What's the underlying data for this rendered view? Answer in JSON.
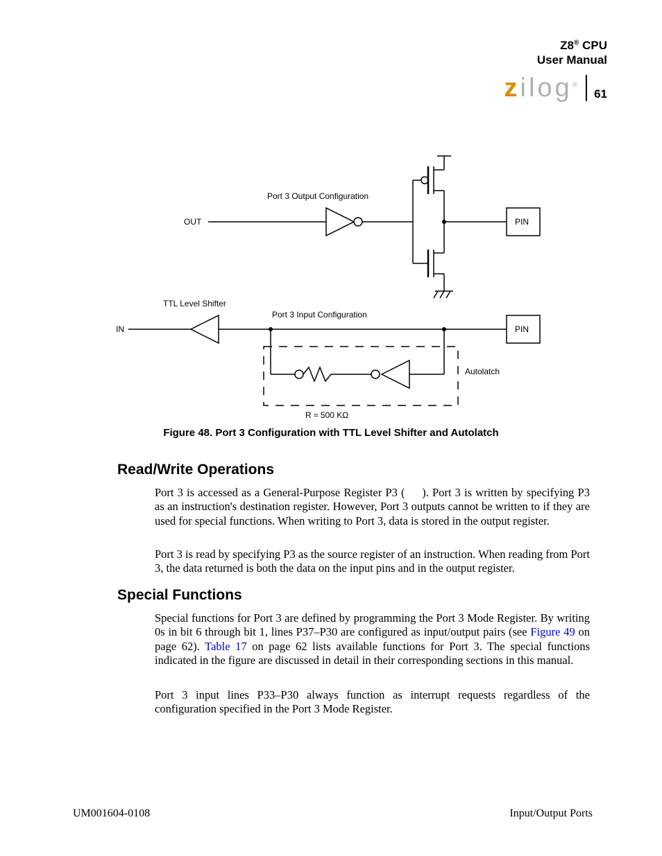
{
  "header": {
    "line1_before_sup": "Z8",
    "line1_sup": "®",
    "line1_after_sup": " CPU",
    "line2": "User Manual"
  },
  "logo": {
    "z": "z",
    "rest": "ilog"
  },
  "page_number": "61",
  "figure": {
    "labels": {
      "output_conf": "Port 3 Output Configuration",
      "input_conf": "Port 3 Input Configuration",
      "out": "OUT",
      "in": "IN",
      "ttl": "TTL Level Shifter",
      "autolatch": "Autolatch",
      "r_approx": "R  ≈  500 KΩ",
      "pin": "PIN"
    },
    "caption": {
      "lead": "Figure 48.",
      "text": " Port 3 Configuration with TTL Level Shifter and Autolatch"
    }
  },
  "sections": {
    "rw_heading": "Read/Write Operations",
    "rw_p1": "Port 3 is accessed as a General-Purpose Register P3 (   ). Port 3 is written by specifying P3 as an instruction's destination register. However, Port 3 outputs cannot be written to if they are used for special functions. When writing to Port 3, data is stored in the output register.",
    "rw_p2": "Port 3 is read by specifying P3 as the source register of an instruction. When reading from Port 3, the data returned is both the data on the input pins and in the output register.",
    "sf_heading": "Special Functions",
    "sf_p1_part1": "Special functions for Port 3 are defined by programming the Port 3 Mode Register. By writing 0s in bit 6 through bit 1, lines P37–P30 are configured as input/output pairs (see ",
    "sf_link1": "Figure 49",
    "sf_p1_part2": " on page 62). ",
    "sf_link2": "Table 17",
    "sf_p1_part3": " on page 62 lists available functions for Port 3. The special functions indicated in the figure are discussed in detail in their corresponding sections in this manual.",
    "sf_p2": "Port 3 input lines P33–P30 always function as interrupt requests regardless of the configuration specified in the Port 3 Mode Register."
  },
  "footer": {
    "left": "UM001604-0108",
    "right": "Input/Output Ports"
  }
}
